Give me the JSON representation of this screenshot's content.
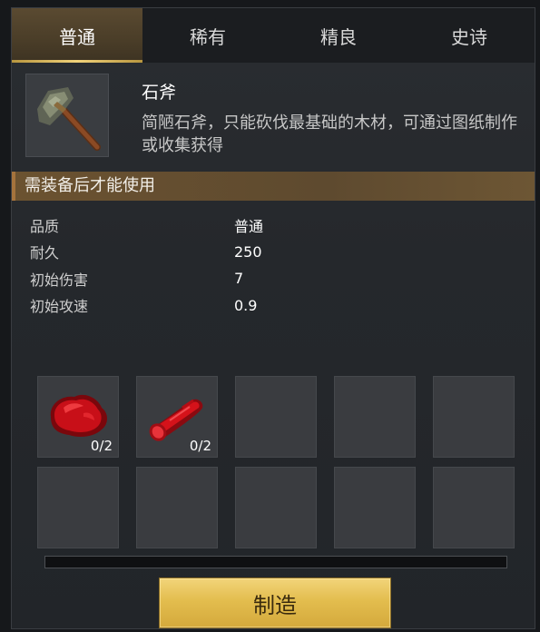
{
  "tabs": [
    {
      "label": "普通",
      "active": true
    },
    {
      "label": "稀有",
      "active": false
    },
    {
      "label": "精良",
      "active": false
    },
    {
      "label": "史诗",
      "active": false
    }
  ],
  "item": {
    "icon": "stone-axe-icon",
    "name": "石斧",
    "description": "简陋石斧，只能砍伐最基础的木材，可通过图纸制作或收集获得"
  },
  "requirement": "需装备后才能使用",
  "stats": [
    {
      "label": "品质",
      "value": "普通"
    },
    {
      "label": "耐久",
      "value": "250"
    },
    {
      "label": "初始伤害",
      "value": "7"
    },
    {
      "label": "初始攻速",
      "value": "0.9"
    }
  ],
  "materials": [
    {
      "icon": "red-stone-icon",
      "count": "0/2"
    },
    {
      "icon": "red-log-icon",
      "count": "0/2"
    }
  ],
  "progress": 0,
  "craft_button": "制造",
  "colors": {
    "accent": "#e3bd4e",
    "material_red": "#d3121c"
  }
}
